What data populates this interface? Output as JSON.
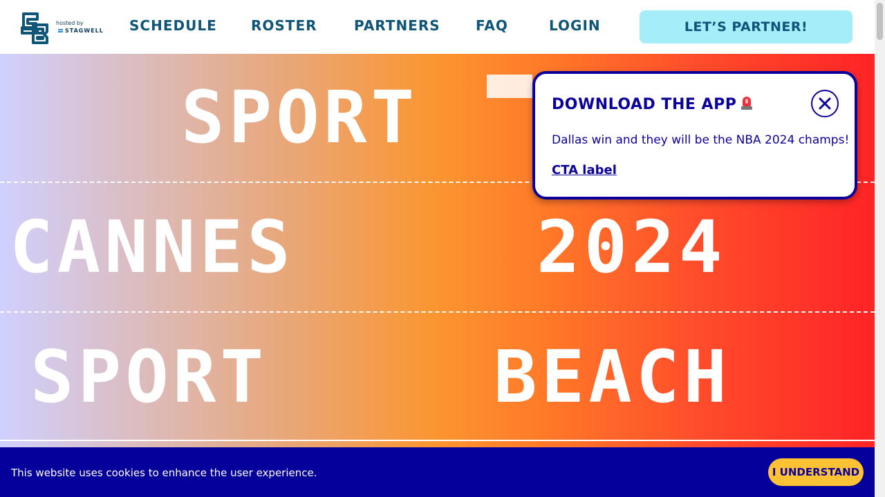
{
  "header": {
    "logo_hosted_by": "hosted by",
    "logo_stagwell": "STAGWELL",
    "nav": [
      "SCHEDULE",
      "ROSTER",
      "PARTNERS",
      "FAQ",
      "LOGIN"
    ],
    "cta_label": "LET’S PARTNER!"
  },
  "hero": {
    "row1": [
      "SPORT"
    ],
    "row2": [
      "CANNES",
      "2024"
    ],
    "row3": [
      "SPORT",
      "BEACH"
    ]
  },
  "popup": {
    "title": "DOWNLOAD THE APP",
    "title_icon": "siren-icon",
    "body": "Dallas win and they will be the NBA 2024 champs!",
    "link": "CTA label",
    "close_icon": "close-icon"
  },
  "cookie": {
    "text": "This website uses cookies to enhance the user experience.",
    "button_label": "I UNDERSTAND"
  },
  "colors": {
    "brand_navy": "#0b0099",
    "nav_text": "#0e5577",
    "cta_bg": "#a6edfa",
    "cookie_bg": "#05009a",
    "cookie_button": "#ffc234"
  }
}
